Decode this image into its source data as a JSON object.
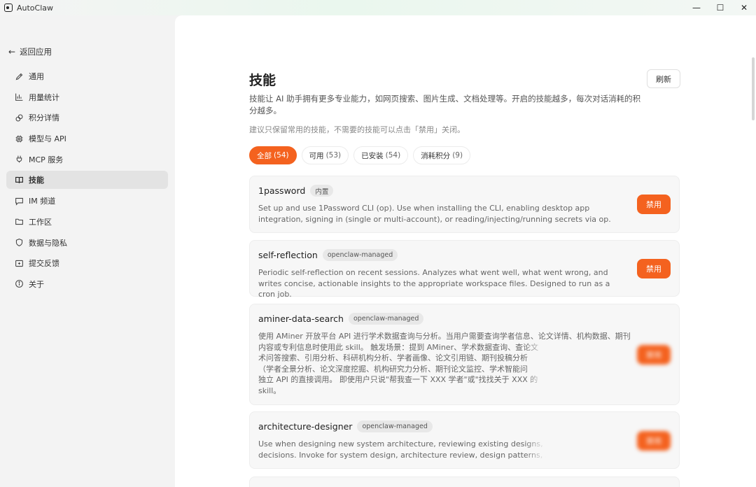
{
  "window": {
    "title": "AutoClaw",
    "minimize": "—",
    "maximize": "☐",
    "close": "✕"
  },
  "sidebar": {
    "back_label": "返回应用",
    "items": [
      {
        "label": "通用",
        "icon": "pencil-icon",
        "active": false
      },
      {
        "label": "用量统计",
        "icon": "bar-chart-icon",
        "active": false
      },
      {
        "label": "积分详情",
        "icon": "coins-icon",
        "active": false
      },
      {
        "label": "模型与 API",
        "icon": "chip-icon",
        "active": false
      },
      {
        "label": "MCP 服务",
        "icon": "plug-icon",
        "active": false
      },
      {
        "label": "技能",
        "icon": "book-icon",
        "active": true
      },
      {
        "label": "IM 频道",
        "icon": "chat-icon",
        "active": false
      },
      {
        "label": "工作区",
        "icon": "folder-icon",
        "active": false
      },
      {
        "label": "数据与隐私",
        "icon": "shield-icon",
        "active": false
      },
      {
        "label": "提交反馈",
        "icon": "feedback-icon",
        "active": false
      },
      {
        "label": "关于",
        "icon": "info-icon",
        "active": false
      }
    ]
  },
  "main": {
    "title": "技能",
    "refresh_label": "刷新",
    "description": "技能让 AI 助手拥有更多专业能力，如网页搜索、图片生成、文档处理等。开启的技能越多，每次对话消耗的积分越多。",
    "hint": "建议只保留常用的技能，不需要的技能可以点击「禁用」关闭。",
    "tabs": [
      {
        "label": "全部",
        "count": "(54)",
        "active": true
      },
      {
        "label": "可用",
        "count": "(53)",
        "active": false
      },
      {
        "label": "已安装",
        "count": "(54)",
        "active": false
      },
      {
        "label": "消耗积分",
        "count": "(9)",
        "active": false
      }
    ],
    "skills": [
      {
        "name": "1password",
        "badge": "内置",
        "description": "Set up and use 1Password CLI (op). Use when installing the CLI, enabling desktop app integration, signing in (single or multi-account), or reading/injecting/running secrets via op.",
        "action": "禁用"
      },
      {
        "name": "self-reflection",
        "badge": "openclaw-managed",
        "description": "Periodic self-reflection on recent sessions. Analyzes what went well, what went wrong, and writes concise, actionable insights to the appropriate workspace files. Designed to run as a cron job.",
        "action": "禁用"
      },
      {
        "name": "aminer-data-search",
        "badge": "openclaw-managed",
        "description_lines": [
          "使用 AMiner 开放平台 API 进行学术数据查询与分析。当用户需要查询学者信息、论文详情、机构数据、期刊",
          "内容或专利信息时使用此 skill。 触发场景：提到 AMiner、学术数据查询、查论文",
          "术问答搜索、引用分析、科研机构分析、学者画像、论文引用链、期刊投稿分析",
          "（学者全景分析、论文深度挖掘、机构研究力分析、期刊论文监控、学术智能问",
          "独立 API 的直接调用。 即使用户只说\"帮我查一下 XXX 学者\"或\"找找关于 XXX 的",
          "skill。"
        ],
        "action": "禁用"
      },
      {
        "name": "architecture-designer",
        "badge": "openclaw-managed",
        "description_lines": [
          "Use when designing new system architecture, reviewing existing designs, or r",
          "decisions. Invoke for system design, architecture review, design patterns, ADI"
        ],
        "action": "禁用"
      }
    ]
  },
  "colors": {
    "accent": "#f4621f",
    "sidebar_bg": "#f3f3f3",
    "card_bg": "#f7f7f7"
  }
}
